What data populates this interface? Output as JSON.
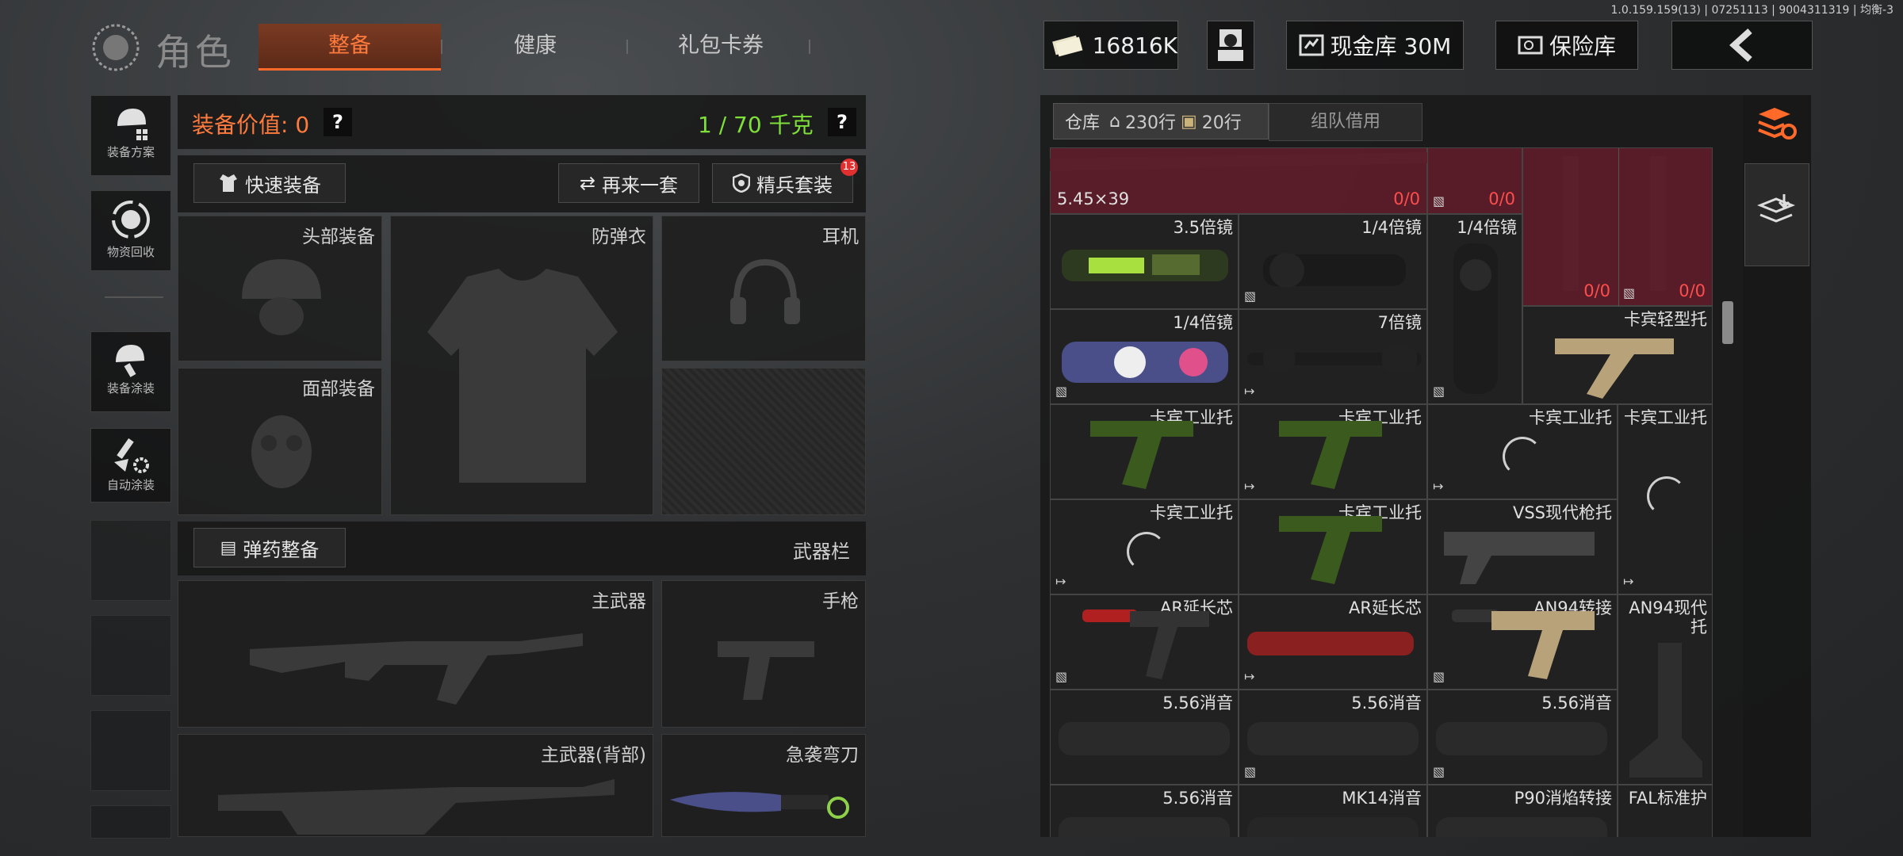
{
  "version": "1.0.159.159(13) | 07251113 | 9004311319 | 均衡-3",
  "header": {
    "title": "角色",
    "tabs": [
      {
        "label": "整备",
        "active": true
      },
      {
        "label": "健康",
        "active": false
      },
      {
        "label": "礼包卡券",
        "active": false
      }
    ],
    "money": "16816K",
    "cash_vault": "现金库 30M",
    "safe": "保险库"
  },
  "sidebar": {
    "items": [
      {
        "label": "装备方案",
        "icon": "helmet-grid-icon"
      },
      {
        "label": "物资回收",
        "icon": "recycle-face-icon"
      },
      {
        "label": "装备涂装",
        "icon": "helmet-brush-icon"
      },
      {
        "label": "自动涂装",
        "icon": "brush-gear-icon"
      }
    ]
  },
  "loadout": {
    "value_label": "装备价值: 0",
    "weight": "1 / 70 千克",
    "quick_equip": "快速装备",
    "repeat": "再来一套",
    "elite_set": "精兵套装",
    "elite_badge": "13",
    "ammo_btn": "弹药整备",
    "weapon_bar": "武器栏",
    "slots": {
      "head": "头部装备",
      "armor": "防弹衣",
      "ear": "耳机",
      "face": "面部装备",
      "primary": "主武器",
      "pistol": "手枪",
      "primary_back": "主武器(背部)",
      "knife": "急袭弯刀"
    }
  },
  "inventory": {
    "tab_warehouse": "仓库",
    "rows_a": "230行",
    "rows_b": "20行",
    "tab_team": "组队借用",
    "top_row": [
      {
        "label": "5.45×39",
        "count": "0/0"
      },
      {
        "label": "",
        "count": "0/0"
      },
      {
        "label": "",
        "count": "0/0"
      }
    ],
    "items": [
      {
        "label": "3.5倍镜"
      },
      {
        "label": "1/4倍镜"
      },
      {
        "label": "1/4倍镜"
      },
      {
        "label": "1/4倍镜"
      },
      {
        "label": "7倍镜"
      },
      {
        "label": "卡宾轻型托"
      },
      {
        "label": "卡宾工业托"
      },
      {
        "label": "卡宾工业托"
      },
      {
        "label": "卡宾工业托"
      },
      {
        "label": "卡宾工业托"
      },
      {
        "label": "卡宾工业托"
      },
      {
        "label": "卡宾工业托"
      },
      {
        "label": "VSS现代枪托"
      },
      {
        "label": "AR延长芯"
      },
      {
        "label": "AR延长芯"
      },
      {
        "label": "AN94转接"
      },
      {
        "label": "AN94现代托"
      },
      {
        "label": "5.56消音"
      },
      {
        "label": "5.56消音"
      },
      {
        "label": "5.56消音"
      },
      {
        "label": "5.56消音"
      },
      {
        "label": "MK14消音"
      },
      {
        "label": "P90消焰转接"
      },
      {
        "label": "FAL标准护"
      }
    ]
  },
  "colors": {
    "accent": "#ff6a2a",
    "weight_green": "#7fe03a",
    "red_count": "#ff4d4d"
  }
}
